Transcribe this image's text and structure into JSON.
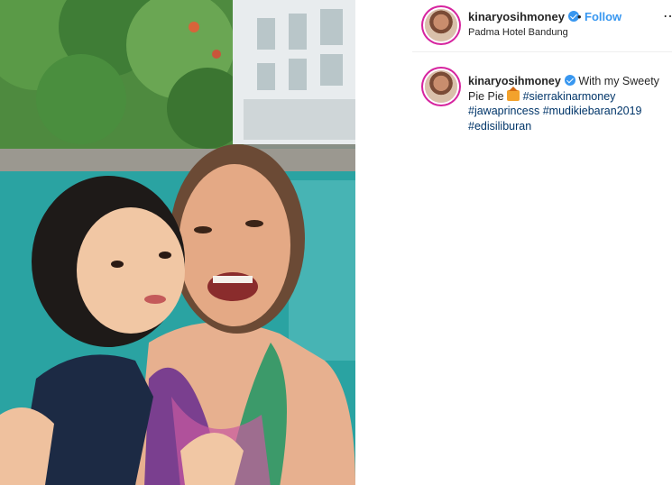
{
  "post": {
    "username": "kinaryosihmoney",
    "dot": "•",
    "follow_label": "Follow",
    "more_icon": "⋯",
    "location": "Padma Hotel Bandung"
  },
  "caption": {
    "username": "kinaryosihmoney",
    "text": "With my Sweety Pie Pie",
    "emoji": "house-emoji",
    "tags": [
      "#sierrakinarmoney",
      "#jawaprincess",
      "#mudikiebaran2019",
      "#edisiliburan"
    ]
  },
  "colors": {
    "accent": "#3897f0",
    "hashtag": "#003569",
    "text": "#262626"
  }
}
